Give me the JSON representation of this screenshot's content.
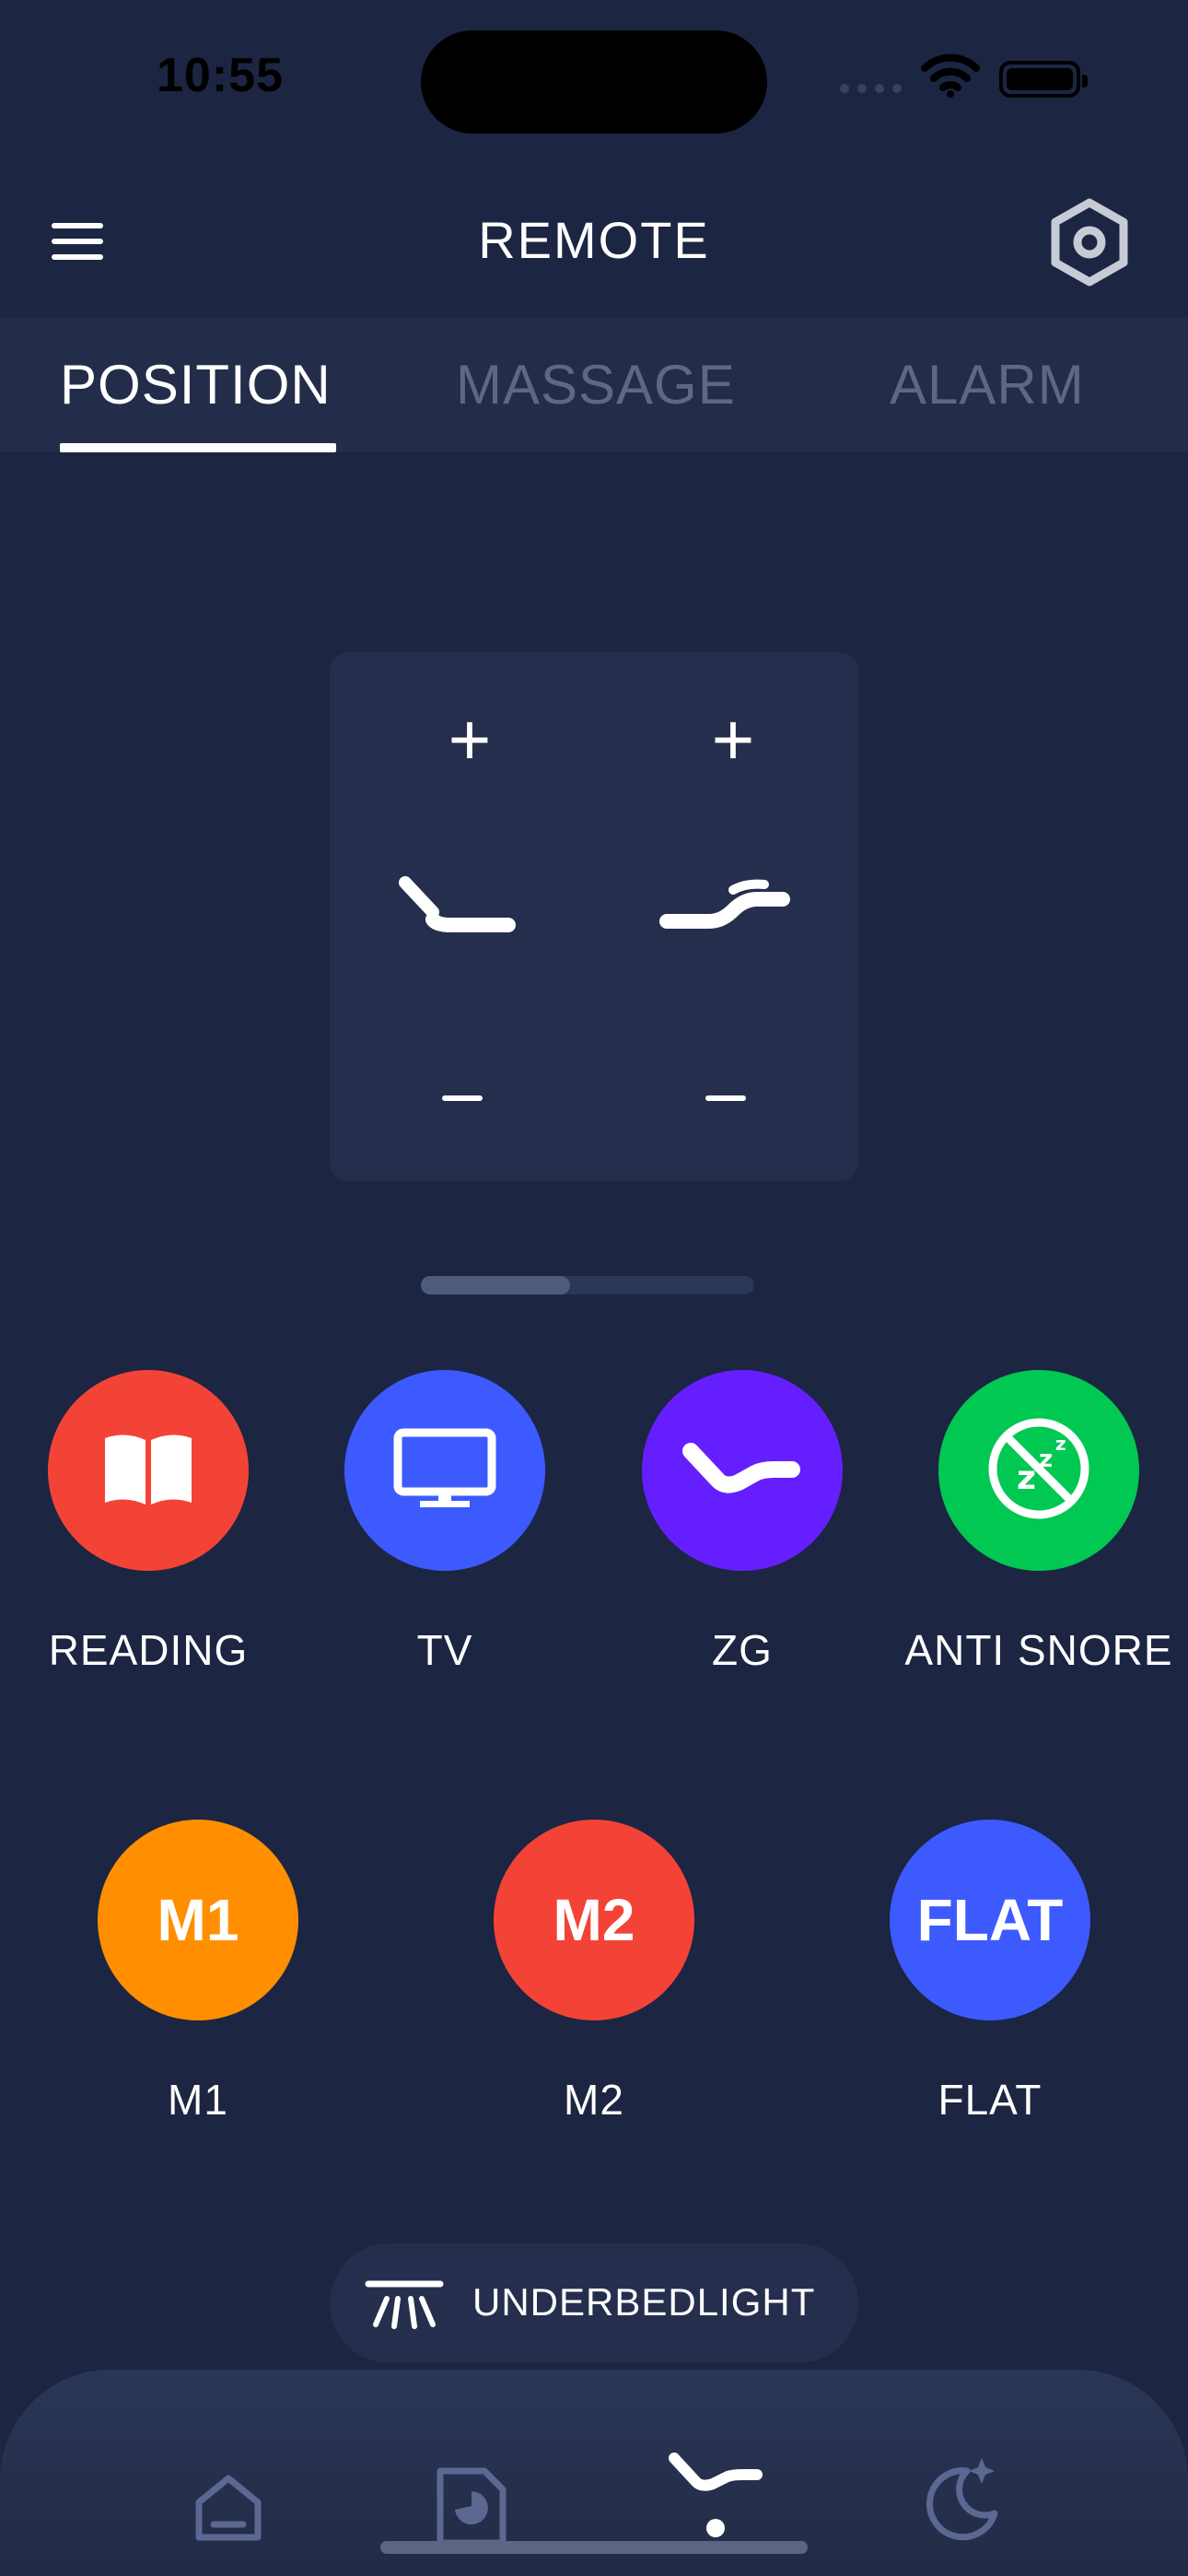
{
  "status_bar": {
    "time": "10:55"
  },
  "header": {
    "title": "REMOTE",
    "menu_icon": "hamburger-menu-icon",
    "settings_icon": "hexagon-settings-icon"
  },
  "tabs": [
    {
      "label": "POSITION",
      "active": true
    },
    {
      "label": "MASSAGE",
      "active": false
    },
    {
      "label": "ALARM",
      "active": false
    }
  ],
  "position_panel": {
    "head": {
      "plus": "+",
      "icon": "head-position-icon"
    },
    "foot": {
      "plus": "+",
      "icon": "foot-position-icon"
    }
  },
  "presets": [
    {
      "label": "READING",
      "color": "#f34336",
      "icon": "book-icon"
    },
    {
      "label": "TV",
      "color": "#3d5afe",
      "icon": "tv-icon"
    },
    {
      "label": "ZG",
      "color": "#651fff",
      "icon": "zero-gravity-icon"
    },
    {
      "label": "ANTI SNORE",
      "color": "#00c853",
      "icon": "no-snore-icon"
    }
  ],
  "memory": [
    {
      "badge": "M1",
      "label": "M1",
      "color": "#ff8f00"
    },
    {
      "badge": "M2",
      "label": "M2",
      "color": "#f34336"
    },
    {
      "badge": "FLAT",
      "label": "FLAT",
      "color": "#3d5afe"
    }
  ],
  "underbed": {
    "label": "UNDERBEDLIGHT",
    "icon": "light-rays-icon"
  },
  "bottom_nav": [
    {
      "icon": "home-icon",
      "active": false
    },
    {
      "icon": "report-icon",
      "active": false
    },
    {
      "icon": "bed-remote-icon",
      "active": true
    },
    {
      "icon": "moon-icon",
      "active": false
    }
  ]
}
